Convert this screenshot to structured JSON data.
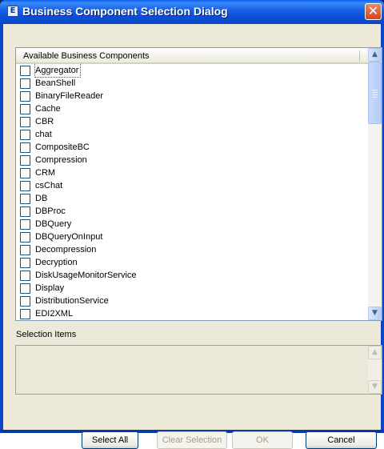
{
  "window": {
    "title": "Business Component Selection Dialog",
    "app_icon_glyph": "E",
    "close_glyph": "✕"
  },
  "available_list": {
    "column_header": "Available Business Components",
    "items": [
      "Aggregator",
      "BeanShell",
      "BinaryFileReader",
      "Cache",
      "CBR",
      "chat",
      "CompositeBC",
      "Compression",
      "CRM",
      "csChat",
      "DB",
      "DBProc",
      "DBQuery",
      "DBQueryOnInput",
      "Decompression",
      "Decryption",
      "DiskUsageMonitorService",
      "Display",
      "DistributionService",
      "EDI2XML"
    ]
  },
  "selection": {
    "label": "Selection Items"
  },
  "buttons": {
    "select_all": "Select All",
    "clear_selection": "Clear Selection",
    "ok": "OK",
    "cancel": "Cancel"
  },
  "icons": {
    "scroll_up": "▲",
    "scroll_down": "▼",
    "scroll_up_name": "scroll-up-arrow-icon",
    "scroll_down_name": "scroll-down-arrow-icon"
  }
}
